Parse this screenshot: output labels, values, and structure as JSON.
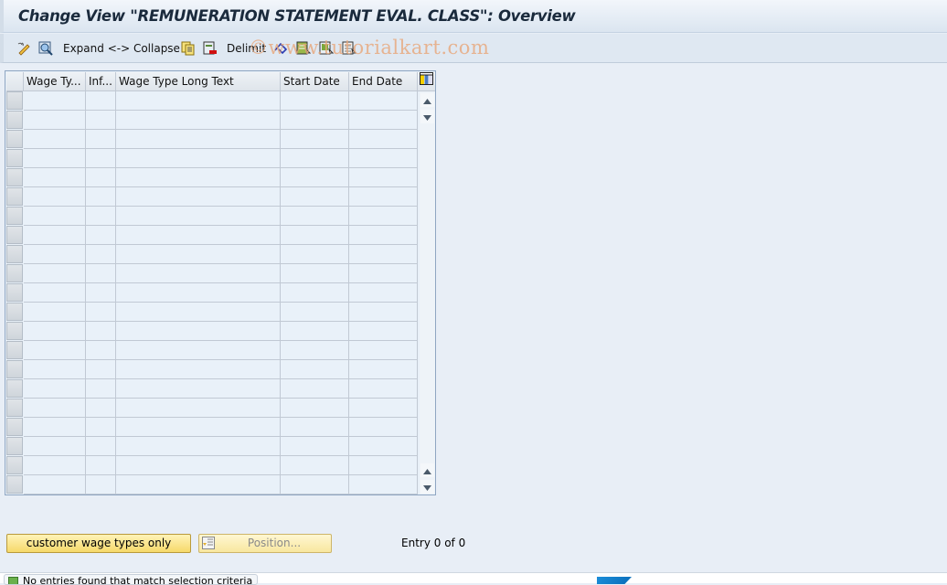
{
  "title": "Change View \"REMUNERATION STATEMENT EVAL. CLASS\": Overview",
  "toolbar": {
    "items": [
      {
        "icon": "edit-toggle-icon",
        "label": ""
      },
      {
        "icon": "details-icon",
        "label": ""
      },
      {
        "icon": "",
        "label": "Expand <-> Collapse"
      },
      {
        "icon": "copy-icon",
        "label": ""
      },
      {
        "icon": "delete-icon",
        "label": ""
      },
      {
        "icon": "",
        "label": "Delimit"
      },
      {
        "icon": "undo-change-icon",
        "label": ""
      },
      {
        "icon": "select-all-icon",
        "label": ""
      },
      {
        "icon": "select-block-icon",
        "label": ""
      },
      {
        "icon": "deselect-all-icon",
        "label": ""
      }
    ],
    "watermark": "©www.tutorialkart.com"
  },
  "table": {
    "columns": [
      "Wage Ty...",
      "Inf...",
      "Wage Type Long Text",
      "Start Date",
      "End Date"
    ],
    "row_count": 21,
    "rows": []
  },
  "buttons": {
    "customer_wage_types": "customer wage types only",
    "position": "Position..."
  },
  "entry_info": "Entry 0 of 0",
  "status_bar": {
    "message": "No entries found that match selection criteria"
  },
  "colors": {
    "accent_button": "#f6d96a",
    "grid_border": "#8fa6c2",
    "background": "#e8eef6"
  }
}
